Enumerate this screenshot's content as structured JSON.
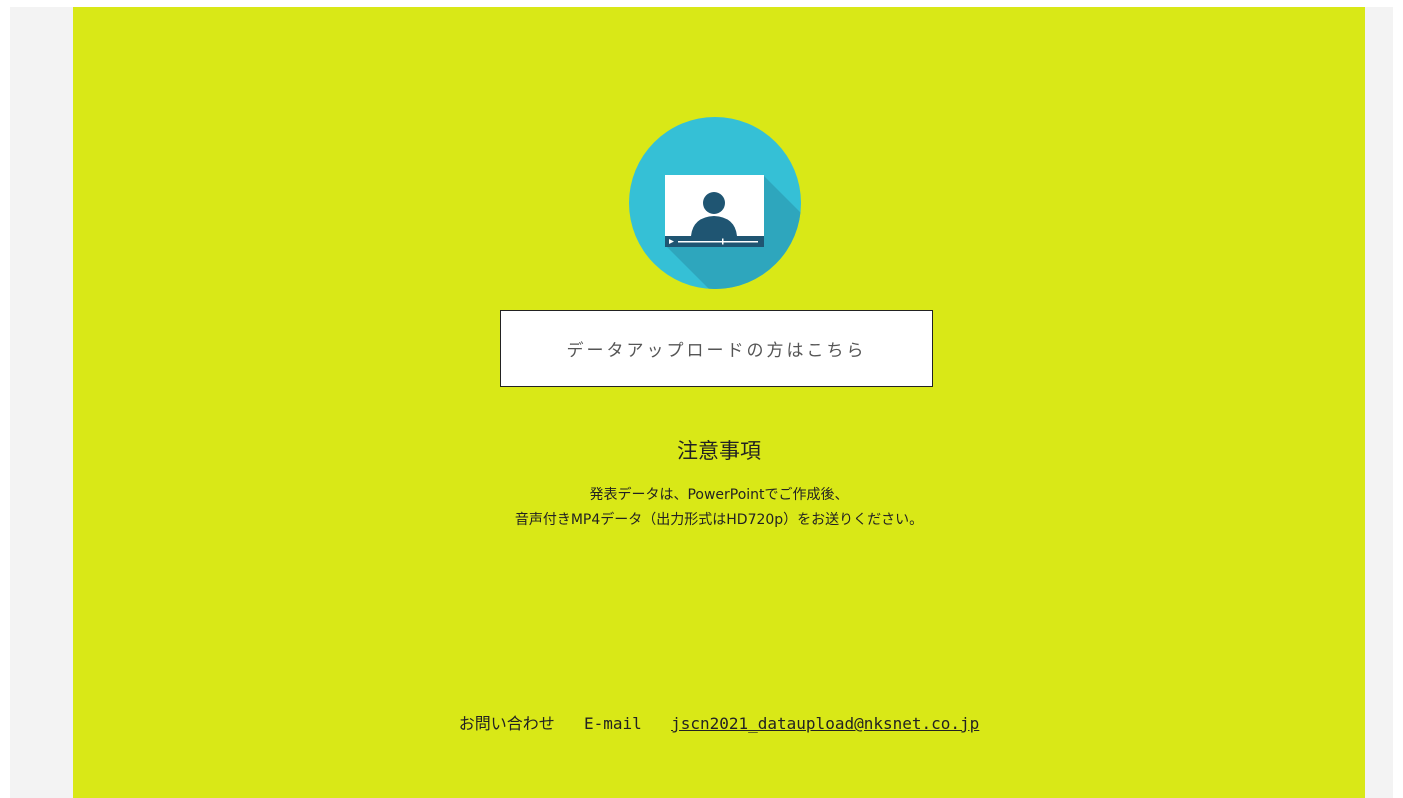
{
  "upload_button": {
    "label": "データアップロードの方はこちら"
  },
  "notice": {
    "title": "注意事項",
    "line1": "発表データは、PowerPointでご作成後、",
    "line2": "音声付きMP4データ（出力形式はHD720p）をお送りください。"
  },
  "contact": {
    "label": "お問い合わせ",
    "email_label": "E-mail",
    "email": "jscn2021_dataupload@nksnet.co.jp"
  },
  "colors": {
    "panel_background": "#d9e817",
    "outer_background": "#f3f3f3",
    "icon_circle": "#35c0d6",
    "icon_shadow": "#2ea6bd",
    "icon_silhouette": "#1f5572"
  },
  "icons": {
    "video": "video-player-person-icon"
  }
}
